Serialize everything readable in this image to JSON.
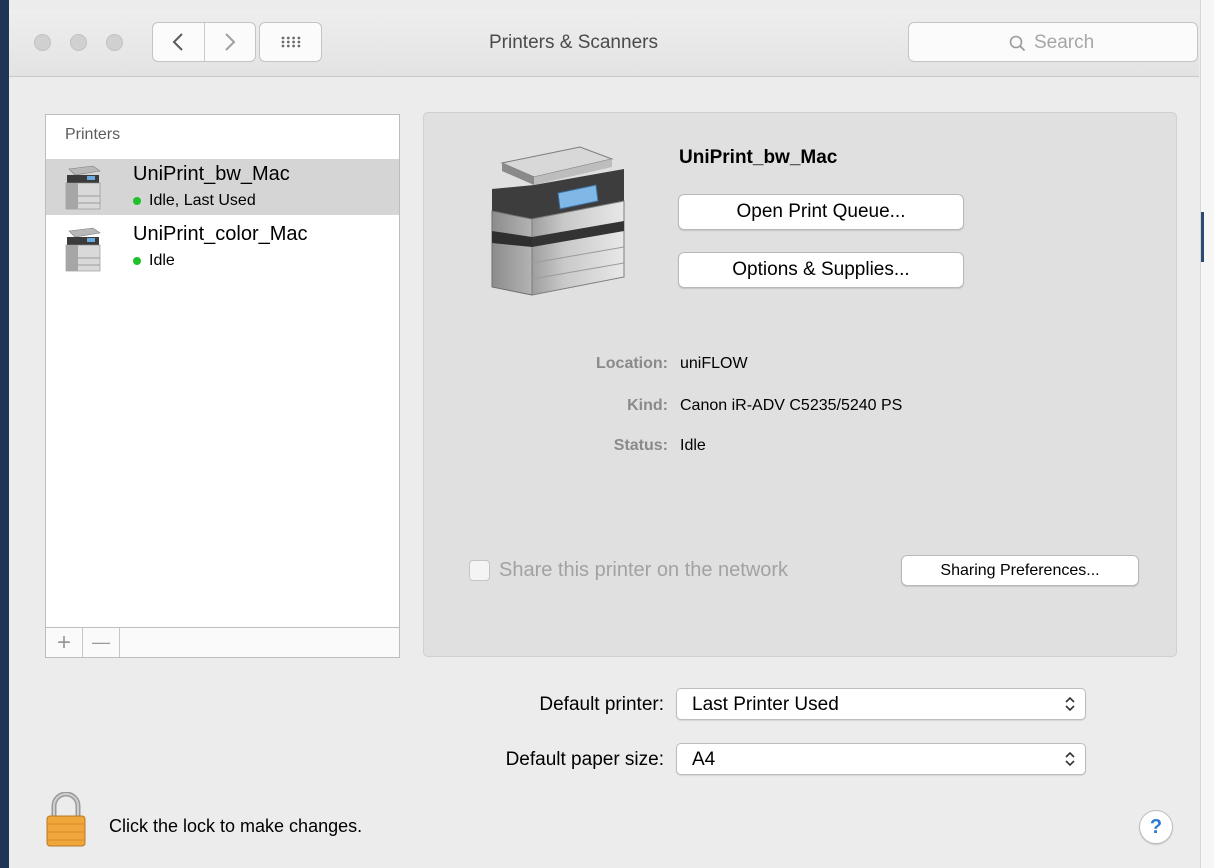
{
  "window": {
    "title": "Printers & Scanners"
  },
  "toolbar": {
    "back_icon": "chevron-left-icon",
    "forward_icon": "chevron-right-icon",
    "grid_icon": "grid-icon",
    "search_placeholder": "Search"
  },
  "printers": {
    "header": "Printers",
    "items": [
      {
        "name": "UniPrint_bw_Mac",
        "status": "Idle, Last Used",
        "selected": true
      },
      {
        "name": "UniPrint_color_Mac",
        "status": "Idle",
        "selected": false
      }
    ],
    "add_label": "+",
    "remove_label": "—"
  },
  "detail": {
    "name": "UniPrint_bw_Mac",
    "open_queue_label": "Open Print Queue...",
    "options_label": "Options & Supplies...",
    "location_label": "Location:",
    "location_value": "uniFLOW",
    "kind_label": "Kind:",
    "kind_value": "Canon iR-ADV C5235/5240 PS",
    "status_label": "Status:",
    "status_value": "Idle",
    "share_label": "Share this printer on the network",
    "share_checked": false,
    "sharing_prefs_label": "Sharing Preferences..."
  },
  "defaults": {
    "printer_label": "Default printer:",
    "printer_value": "Last Printer Used",
    "paper_label": "Default paper size:",
    "paper_value": "A4"
  },
  "footer": {
    "lock_text": "Click the lock to make changes.",
    "help_label": "?"
  },
  "colors": {
    "status_dot": "#1fc12a",
    "help_blue": "#2a7bd8",
    "lock_gold": "#f0a63a"
  }
}
